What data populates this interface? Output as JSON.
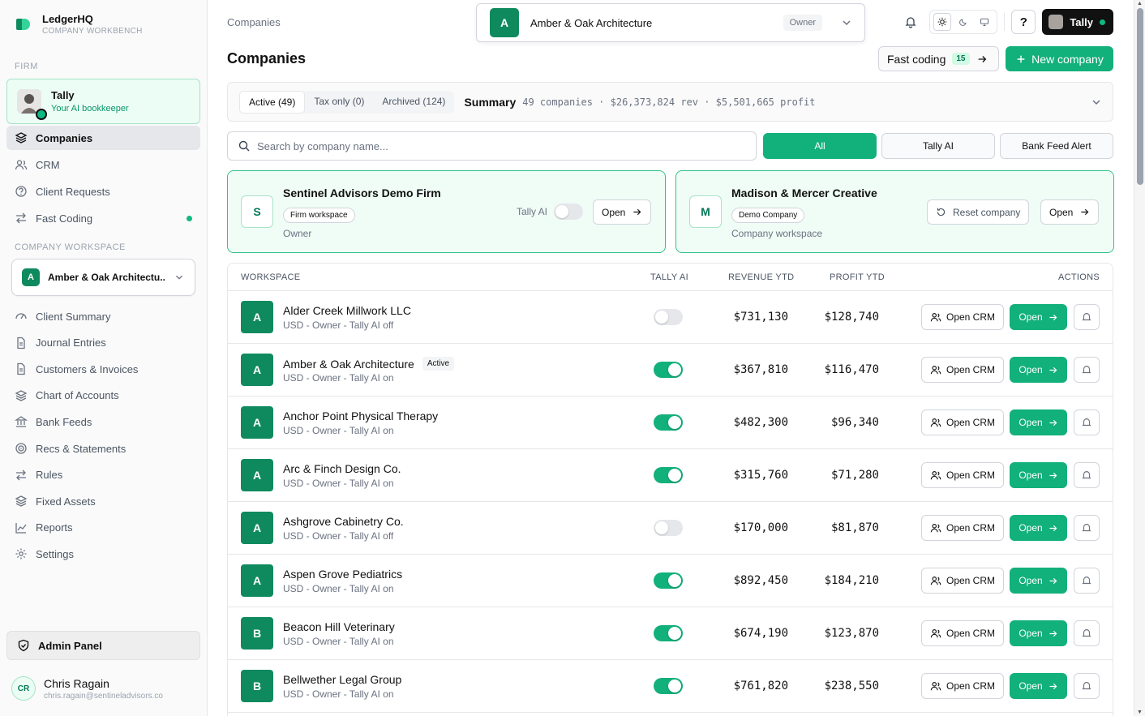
{
  "brand": {
    "name": "LedgerHQ",
    "subtitle": "COMPANY WORKBENCH"
  },
  "sidebar": {
    "firm_label": "FIRM",
    "tally": {
      "name": "Tally",
      "subtitle": "Your AI bookkeeper"
    },
    "firm_items": [
      {
        "label": "Companies",
        "icon": "layers-icon",
        "active": true
      },
      {
        "label": "CRM",
        "icon": "users-icon"
      },
      {
        "label": "Client Requests",
        "icon": "help-circle-icon"
      },
      {
        "label": "Fast Coding",
        "icon": "arrows-icon",
        "dot": true
      }
    ],
    "workspace_label": "COMPANY WORKSPACE",
    "workspace": {
      "badge": "A",
      "name": "Amber & Oak Architectu..."
    },
    "workspace_items": [
      {
        "label": "Client Summary",
        "icon": "gauge-icon"
      },
      {
        "label": "Journal Entries",
        "icon": "file-icon"
      },
      {
        "label": "Customers & Invoices",
        "icon": "file-icon"
      },
      {
        "label": "Chart of Accounts",
        "icon": "layers-icon"
      },
      {
        "label": "Bank Feeds",
        "icon": "bank-icon"
      },
      {
        "label": "Recs & Statements",
        "icon": "target-icon"
      },
      {
        "label": "Rules",
        "icon": "arrows-icon"
      },
      {
        "label": "Fixed Assets",
        "icon": "layers-icon"
      },
      {
        "label": "Reports",
        "icon": "chart-icon"
      },
      {
        "label": "Settings",
        "icon": "gear-icon"
      }
    ],
    "admin_label": "Admin Panel",
    "user": {
      "initials": "CR",
      "name": "Chris Ragain",
      "email": "chris.ragain@sentineladvisors.co"
    }
  },
  "header": {
    "breadcrumb": "Companies",
    "company": {
      "badge": "A",
      "name": "Amber & Oak Architecture",
      "role": "Owner"
    },
    "tally_button": "Tally",
    "help": "?"
  },
  "page": {
    "title": "Companies",
    "fast_coding": {
      "label": "Fast coding",
      "count": "15"
    },
    "new_company": "New company"
  },
  "summary": {
    "tabs": [
      {
        "label": "Active (49)",
        "active": true
      },
      {
        "label": "Tax only (0)"
      },
      {
        "label": "Archived (124)"
      }
    ],
    "title": "Summary",
    "text": "49 companies · $26,373,824 rev · $5,501,665 profit"
  },
  "search": {
    "placeholder": "Search by company name..."
  },
  "filters": [
    {
      "label": "All",
      "active": true
    },
    {
      "label": "Tally AI"
    },
    {
      "label": "Bank Feed Alert"
    }
  ],
  "cards": [
    {
      "badge": "S",
      "name": "Sentinel Advisors Demo Firm",
      "tag": "Firm workspace",
      "sub": "Owner",
      "toggle_label": "Tally AI",
      "toggle_on": false,
      "open": "Open"
    },
    {
      "badge": "M",
      "name": "Madison & Mercer Creative",
      "tag": "Demo Company",
      "sub": "Company workspace",
      "reset": "Reset company",
      "open": "Open"
    }
  ],
  "table": {
    "headers": {
      "workspace": "WORKSPACE",
      "tally": "TALLY AI",
      "revenue": "REVENUE YTD",
      "profit": "PROFIT YTD",
      "actions": "ACTIONS"
    },
    "crm_label": "Open CRM",
    "open_label": "Open",
    "rows": [
      {
        "badge": "A",
        "name": "Alder Creek Millwork LLC",
        "sub": "USD - Owner - Tally AI off",
        "tally_on": false,
        "revenue": "$731,130",
        "profit": "$128,740"
      },
      {
        "badge": "A",
        "name": "Amber & Oak Architecture",
        "active_tag": "Active",
        "sub": "USD - Owner - Tally AI on",
        "tally_on": true,
        "revenue": "$367,810",
        "profit": "$116,470"
      },
      {
        "badge": "A",
        "name": "Anchor Point Physical Therapy",
        "sub": "USD - Owner - Tally AI on",
        "tally_on": true,
        "revenue": "$482,300",
        "profit": "$96,340"
      },
      {
        "badge": "A",
        "name": "Arc & Finch Design Co.",
        "sub": "USD - Owner - Tally AI on",
        "tally_on": true,
        "revenue": "$315,760",
        "profit": "$71,280"
      },
      {
        "badge": "A",
        "name": "Ashgrove Cabinetry Co.",
        "sub": "USD - Owner - Tally AI off",
        "tally_on": false,
        "revenue": "$170,000",
        "profit": "$81,870"
      },
      {
        "badge": "A",
        "name": "Aspen Grove Pediatrics",
        "sub": "USD - Owner - Tally AI on",
        "tally_on": true,
        "revenue": "$892,450",
        "profit": "$184,210"
      },
      {
        "badge": "B",
        "name": "Beacon Hill Veterinary",
        "sub": "USD - Owner - Tally AI on",
        "tally_on": true,
        "revenue": "$674,190",
        "profit": "$123,870"
      },
      {
        "badge": "B",
        "name": "Bellwether Legal Group",
        "sub": "USD - Owner - Tally AI on",
        "tally_on": true,
        "revenue": "$761,820",
        "profit": "$238,550"
      }
    ]
  },
  "colors": {
    "accent": "#12b07a",
    "badge": "#0f8a5f",
    "card_bg": "#f0fdf7",
    "card_border": "#34c08a"
  }
}
